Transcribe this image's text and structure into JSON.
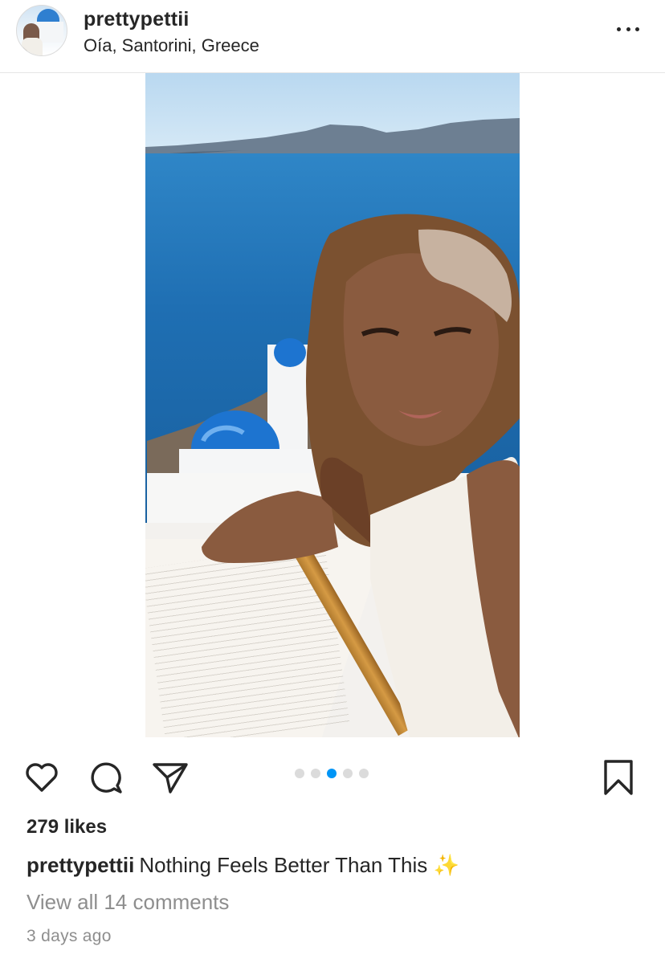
{
  "post": {
    "username": "prettypettii",
    "location": "Oía, Santorini, Greece"
  },
  "media": {
    "carousel_count": 5,
    "active_index": 2
  },
  "engagement": {
    "likes_text": "279 likes",
    "caption_username": "prettypettii",
    "caption_text": "Nothing Feels Better Than This ✨",
    "view_comments_text": "View all 14 comments",
    "timestamp": "3 days ago"
  },
  "icons": {
    "more": "more-options-icon",
    "like": "heart-icon",
    "comment": "comment-icon",
    "share": "send-icon",
    "save": "bookmark-icon"
  },
  "colors": {
    "text": "#262626",
    "secondary_text": "#8e8e8e",
    "active_dot": "#0095f6",
    "inactive_dot": "#dbdbdb",
    "divider": "#e6e6e6"
  }
}
